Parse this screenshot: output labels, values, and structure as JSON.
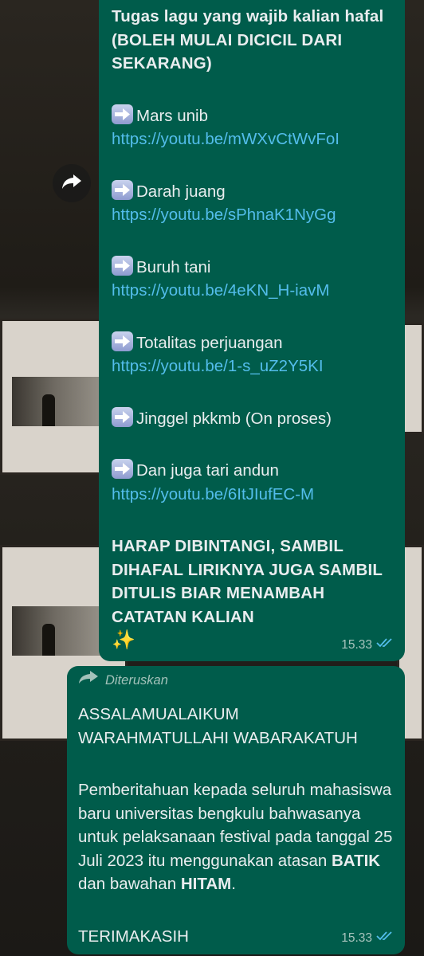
{
  "message1": {
    "title": "Tugas lagu yang wajib kalian hafal (BOLEH MULAI DICICIL DARI SEKARANG)",
    "items": [
      {
        "emoji": "right-arrow-emoji",
        "label": "Mars unib",
        "link": "https://youtu.be/mWXvCtWvFoI"
      },
      {
        "emoji": "right-arrow-emoji",
        "label": "Darah juang",
        "link": "https://youtu.be/sPhnaK1NyGg"
      },
      {
        "emoji": "right-arrow-emoji",
        "label": "Buruh tani",
        "link": "https://youtu.be/4eKN_H-iavM"
      },
      {
        "emoji": "right-arrow-emoji",
        "label": "Totalitas perjuangan",
        "link": "https://youtu.be/1-s_uZ2Y5KI"
      },
      {
        "emoji": "right-arrow-emoji",
        "label": "Jinggel pkkmb (On proses)",
        "link": ""
      },
      {
        "emoji": "right-arrow-emoji",
        "label": "Dan juga tari andun",
        "link": "https://youtu.be/6ItJIufEC-M"
      }
    ],
    "footer": "HARAP DIBINTANGI, SAMBIL DIHAFAL LIRIKNYA JUGA SAMBIL DITULIS BIAR MENAMBAH CATATAN KALIAN",
    "footer_emoji": "✨",
    "time": "15.33",
    "status_icon": "double-check-icon"
  },
  "message2": {
    "forwarded_label": "Diteruskan",
    "greeting": "ASSALAMUALAIKUM WARAHMATULLAHI WABARAKATUH",
    "body_prefix": "Pemberitahuan kepada seluruh mahasiswa baru universitas bengkulu bahwasanya untuk pelaksanaan festival pada tanggal 25 Juli 2023 itu menggunakan atasan ",
    "body_bold1": "BATIK",
    "body_middle": " dan bawahan ",
    "body_bold2": "HITAM",
    "body_suffix": ".",
    "closing": "TERIMAKASIH",
    "time": "15.33",
    "status_icon": "double-check-icon"
  },
  "colors": {
    "bubble": "#005c4b",
    "text": "#e9edef",
    "link": "#53bdeb",
    "meta": "#a7c4bd"
  }
}
